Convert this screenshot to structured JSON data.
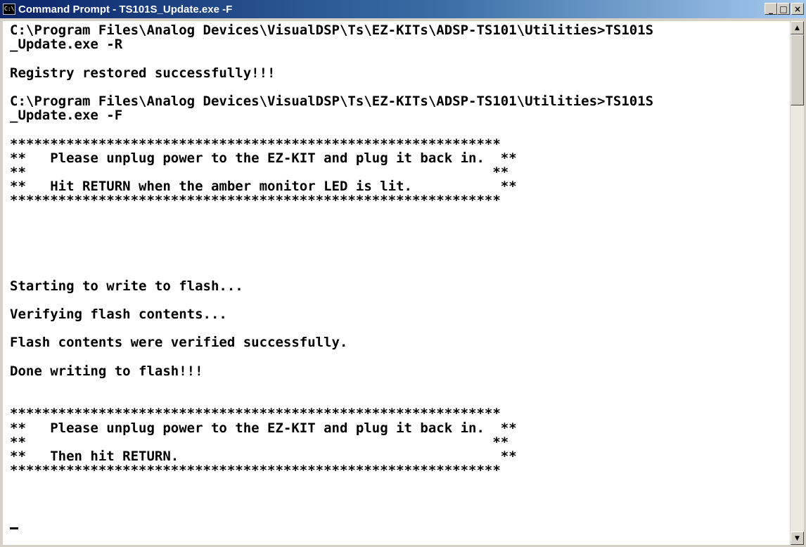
{
  "window": {
    "title": "Command Prompt - TS101S_Update.exe -F",
    "icon_label": "C:\\",
    "minimize_glyph": "_",
    "maximize_glyph": "□",
    "close_glyph": "×"
  },
  "console": {
    "lines": [
      "C:\\Program Files\\Analog Devices\\VisualDSP\\Ts\\EZ-KITs\\ADSP-TS101\\Utilities>TS101S",
      "_Update.exe -R",
      "",
      "Registry restored successfully!!!",
      "",
      "C:\\Program Files\\Analog Devices\\VisualDSP\\Ts\\EZ-KITs\\ADSP-TS101\\Utilities>TS101S",
      "_Update.exe -F",
      "",
      "*************************************************************",
      "**   Please unplug power to the EZ-KIT and plug it back in.  **",
      "**                                                          **",
      "**   Hit RETURN when the amber monitor LED is lit.           **",
      "*************************************************************",
      "",
      "",
      "",
      "",
      "",
      "Starting to write to flash...",
      "",
      "Verifying flash contents...",
      "",
      "Flash contents were verified successfully.",
      "",
      "Done writing to flash!!!",
      "",
      "",
      "*************************************************************",
      "**   Please unplug power to the EZ-KIT and plug it back in.  **",
      "**                                                          **",
      "**   Then hit RETURN.                                        **",
      "*************************************************************"
    ]
  },
  "scrollbar": {
    "up_glyph": "▲",
    "down_glyph": "▼"
  }
}
